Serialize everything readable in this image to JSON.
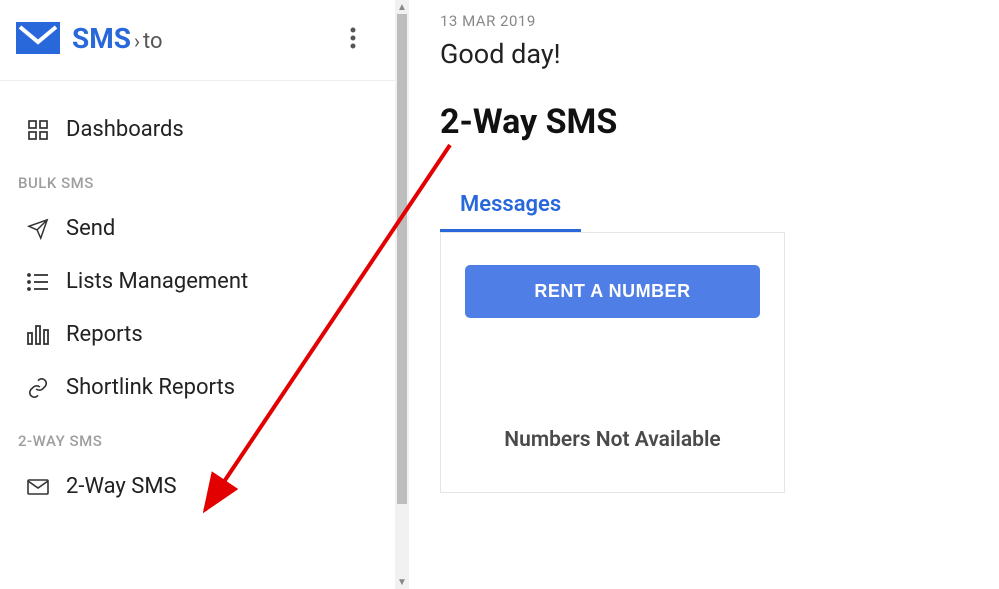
{
  "logo": {
    "brand": "SMS",
    "suffix": "to"
  },
  "sidebar": {
    "dashboards": "Dashboards",
    "section_bulk": "BULK SMS",
    "send": "Send",
    "lists": "Lists Management",
    "reports": "Reports",
    "shortlink": "Shortlink Reports",
    "section_2way": "2-WAY SMS",
    "twoway": "2-Way SMS"
  },
  "main": {
    "date": "13 MAR 2019",
    "greeting": "Good day!",
    "title": "2-Way SMS",
    "tab_messages": "Messages",
    "rent_button": "RENT A NUMBER",
    "not_available": "Numbers Not Available"
  }
}
